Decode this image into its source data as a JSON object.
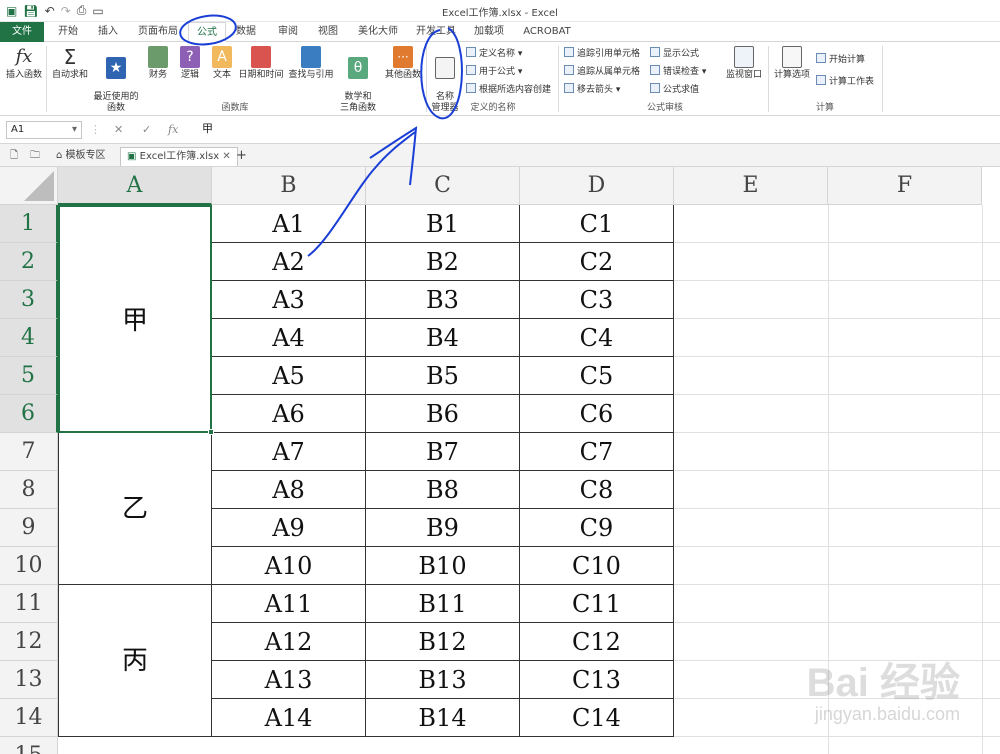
{
  "window": {
    "title": "Excel工作簿.xlsx - Excel"
  },
  "menu": {
    "tabs": [
      "文件",
      "开始",
      "插入",
      "页面布局",
      "公式",
      "数据",
      "审阅",
      "视图",
      "美化大师",
      "开发工具",
      "加载项",
      "ACROBAT"
    ],
    "active": "公式"
  },
  "ribbon": {
    "insert_function": "插入函数",
    "autosum": "自动求和",
    "recent": "最近使用的\n函数",
    "financial": "财务",
    "logical": "逻辑",
    "text": "文本",
    "datetime": "日期和时间",
    "lookup": "查找与引用",
    "math": "数学和\n三角函数",
    "other": "其他函数",
    "group_library": "函数库",
    "name_manager": "名称\n管理器",
    "define_name": "定义名称",
    "use_in_formula": "用于公式",
    "create_from_selection": "根据所选内容创建",
    "group_names": "定义的名称",
    "trace_precedents": "追踪引用单元格",
    "trace_dependents": "追踪从属单元格",
    "remove_arrows": "移去箭头",
    "show_formulas": "显示公式",
    "error_checking": "错误检查",
    "evaluate": "公式求值",
    "group_audit": "公式审核",
    "watch_window": "监视窗口",
    "calc_options": "计算选项",
    "calc_now": "开始计算",
    "calc_sheet": "计算工作表",
    "group_calc": "计算"
  },
  "formula_bar": {
    "name_box": "A1",
    "fx": "fx",
    "content": "甲"
  },
  "sheet_tabs": {
    "template": "模板专区",
    "file": "Excel工作簿.xlsx",
    "add": "+"
  },
  "columns": [
    "A",
    "B",
    "C",
    "D",
    "E",
    "F"
  ],
  "rows": [
    "1",
    "2",
    "3",
    "4",
    "5",
    "6",
    "7",
    "8",
    "9",
    "10",
    "11",
    "12",
    "13",
    "14",
    "15"
  ],
  "merged": [
    "甲",
    "乙",
    "丙"
  ],
  "cells": {
    "B": [
      "A1",
      "A2",
      "A3",
      "A4",
      "A5",
      "A6",
      "A7",
      "A8",
      "A9",
      "A10",
      "A11",
      "A12",
      "A13",
      "A14"
    ],
    "C": [
      "B1",
      "B2",
      "B3",
      "B4",
      "B5",
      "B6",
      "B7",
      "B8",
      "B9",
      "B10",
      "B11",
      "B12",
      "B13",
      "B14"
    ],
    "D": [
      "C1",
      "C2",
      "C3",
      "C4",
      "C5",
      "C6",
      "C7",
      "C8",
      "C9",
      "C10",
      "C11",
      "C12",
      "C13",
      "C14"
    ]
  },
  "watermark": {
    "brand": "Bai 经验",
    "url": "jingyan.baidu.com"
  }
}
